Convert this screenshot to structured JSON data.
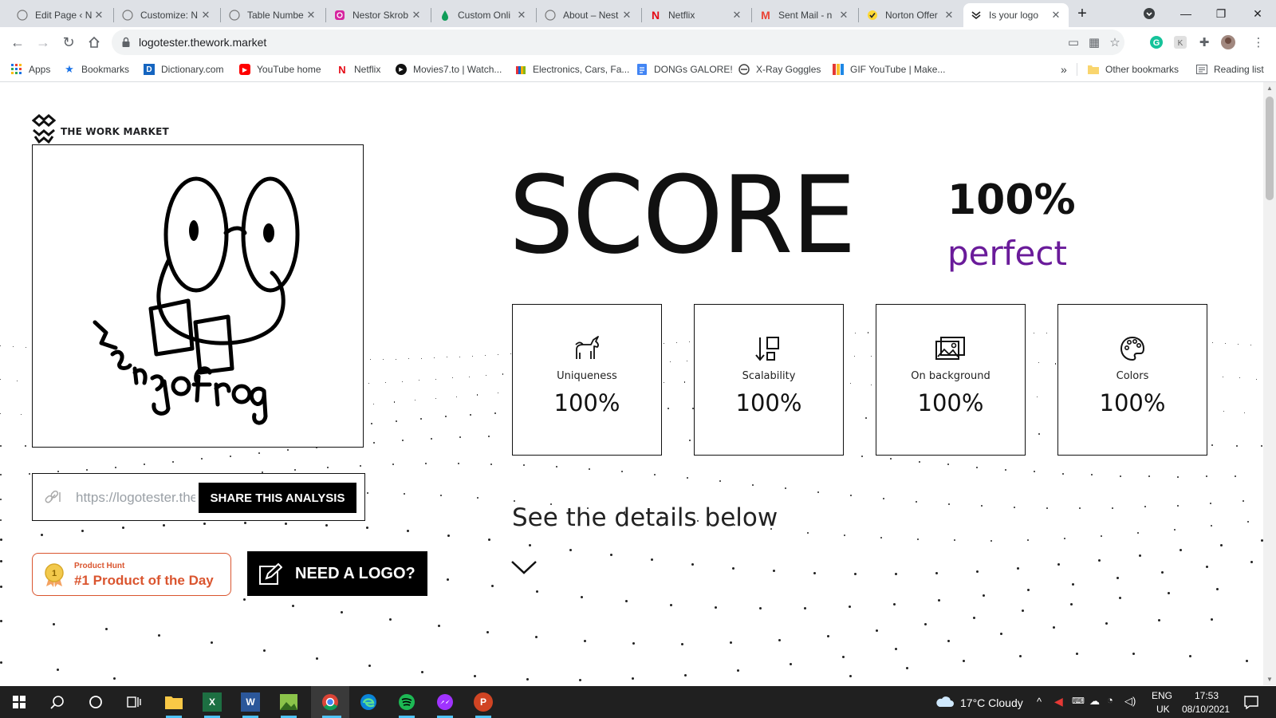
{
  "browser": {
    "tabs": [
      {
        "title": "Edit Page ‹ N",
        "icon": "wordpress-icon",
        "active": false
      },
      {
        "title": "Customize: N",
        "icon": "wordpress-icon",
        "active": false
      },
      {
        "title": "Table Numbe",
        "icon": "wordpress-icon",
        "active": false
      },
      {
        "title": "Nestor Skrob",
        "icon": "instagram-icon",
        "active": false
      },
      {
        "title": "Custom Onli",
        "icon": "drop-icon",
        "active": false
      },
      {
        "title": "About – Nest",
        "icon": "wordpress-icon",
        "active": false
      },
      {
        "title": "Netflix",
        "icon": "netflix-icon",
        "active": false
      },
      {
        "title": "Sent Mail - n",
        "icon": "gmail-icon",
        "active": false
      },
      {
        "title": "Norton Offer",
        "icon": "norton-icon",
        "active": false
      },
      {
        "title": "Is your logo",
        "icon": "workmarket-icon",
        "active": true
      }
    ],
    "url": "logotester.thework.market",
    "bookmarks": [
      {
        "label": "Apps",
        "icon": "apps-grid-icon"
      },
      {
        "label": "Bookmarks",
        "icon": "star-icon"
      },
      {
        "label": "Dictionary.com",
        "icon": "dictionary-icon"
      },
      {
        "label": "YouTube home",
        "icon": "youtube-icon"
      },
      {
        "label": "Netflix",
        "icon": "netflix-icon"
      },
      {
        "label": "Movies7.to | Watch...",
        "icon": "play-icon"
      },
      {
        "label": "Electronics, Cars, Fa...",
        "icon": "ebay-icon"
      },
      {
        "label": "DONGs GALORE!",
        "icon": "doc-icon"
      },
      {
        "label": "X-Ray Goggles",
        "icon": "xray-icon"
      },
      {
        "label": "GIF YouTube | Make...",
        "icon": "gif-icon"
      }
    ],
    "more_bookmarks": "»",
    "other_bookmarks": "Other bookmarks",
    "reading_list": "Reading list"
  },
  "page": {
    "brand_name": "THE WORK MARKET",
    "logo_caption": "MangoFrog",
    "share": {
      "value": "https://logotester.thework.market",
      "button": "SHARE THIS ANALYSIS"
    },
    "product_hunt": {
      "small": "Product Hunt",
      "large": "#1 Product of the Day",
      "rank": "1"
    },
    "need_logo": "NEED A LOGO?",
    "score": {
      "title": "SCORE",
      "value": "100%",
      "grade": "perfect"
    },
    "metrics": [
      {
        "label": "Uniqueness",
        "value": "100%",
        "icon": "unicorn-icon"
      },
      {
        "label": "Scalability",
        "value": "100%",
        "icon": "scale-icon"
      },
      {
        "label": "On background",
        "value": "100%",
        "icon": "image-background-icon"
      },
      {
        "label": "Colors",
        "value": "100%",
        "icon": "palette-icon"
      }
    ],
    "details_heading": "See the details below"
  },
  "taskbar": {
    "weather": "17°C  Cloudy",
    "lang1": "ENG",
    "lang2": "UK",
    "time": "17:53",
    "date": "08/10/2021"
  },
  "colors": {
    "accent_purple": "#6a1b9a",
    "producthunt": "#da552f",
    "taskbar": "#202020"
  }
}
